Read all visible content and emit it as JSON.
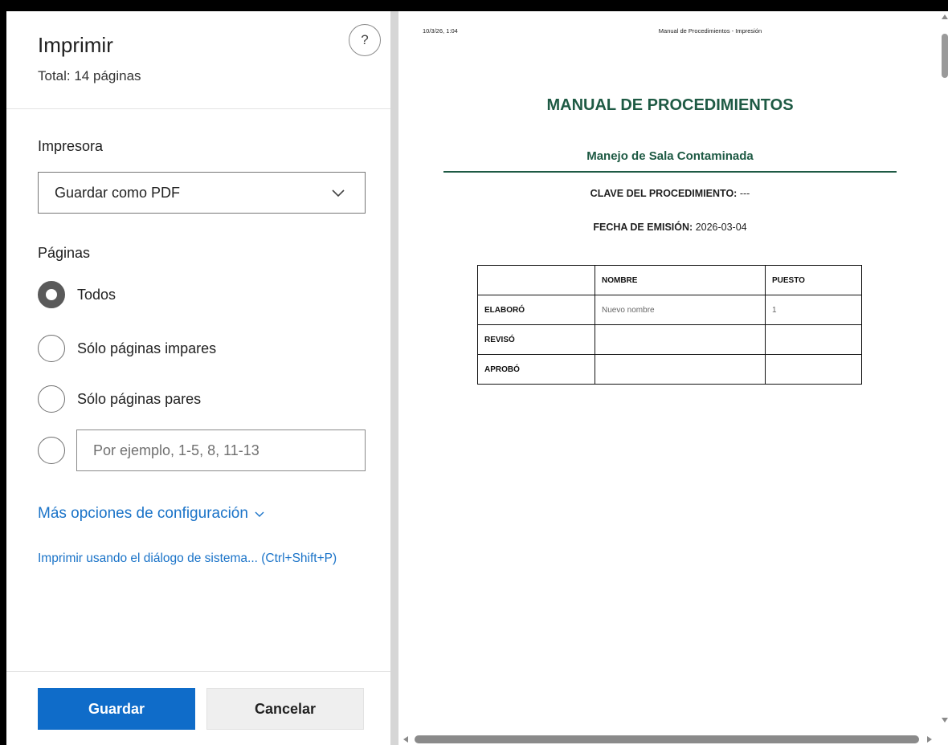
{
  "dialog": {
    "title": "Imprimir",
    "total_pages": "Total: 14 páginas",
    "help_symbol": "?"
  },
  "printer": {
    "label": "Impresora",
    "selected": "Guardar como PDF"
  },
  "pages": {
    "label": "Páginas",
    "options": [
      {
        "label": "Todos",
        "checked": true
      },
      {
        "label": "Sólo páginas impares",
        "checked": false
      },
      {
        "label": "Sólo páginas pares",
        "checked": false
      }
    ],
    "custom_placeholder": "Por ejemplo, 1-5, 8, 11-13"
  },
  "links": {
    "more_settings": "Más opciones de configuración",
    "system_dialog": "Imprimir usando el diálogo de sistema... (Ctrl+Shift+P)"
  },
  "buttons": {
    "save": "Guardar",
    "cancel": "Cancelar"
  },
  "preview": {
    "header_left": "10/3/26, 1:04",
    "header_center": "Manual de Procedimientos - Impresión",
    "doc_title": "MANUAL DE PROCEDIMIENTOS",
    "doc_subtitle": "Manejo de Sala Contaminada",
    "key_label": "CLAVE DEL PROCEDIMIENTO:",
    "key_value": "---",
    "date_label": "FECHA DE EMISIÓN:",
    "date_value": "2026-03-04",
    "table": {
      "headers": [
        "",
        "NOMBRE",
        "PUESTO"
      ],
      "rows": [
        {
          "role": "ELABORÓ",
          "nombre": "Nuevo nombre",
          "puesto": "1"
        },
        {
          "role": "REVISÓ",
          "nombre": "",
          "puesto": ""
        },
        {
          "role": "APROBÓ",
          "nombre": "",
          "puesto": ""
        }
      ]
    }
  },
  "colors": {
    "accent": "#0f6cc9",
    "link": "#1a73c8",
    "doc_green": "#1e5a44"
  }
}
